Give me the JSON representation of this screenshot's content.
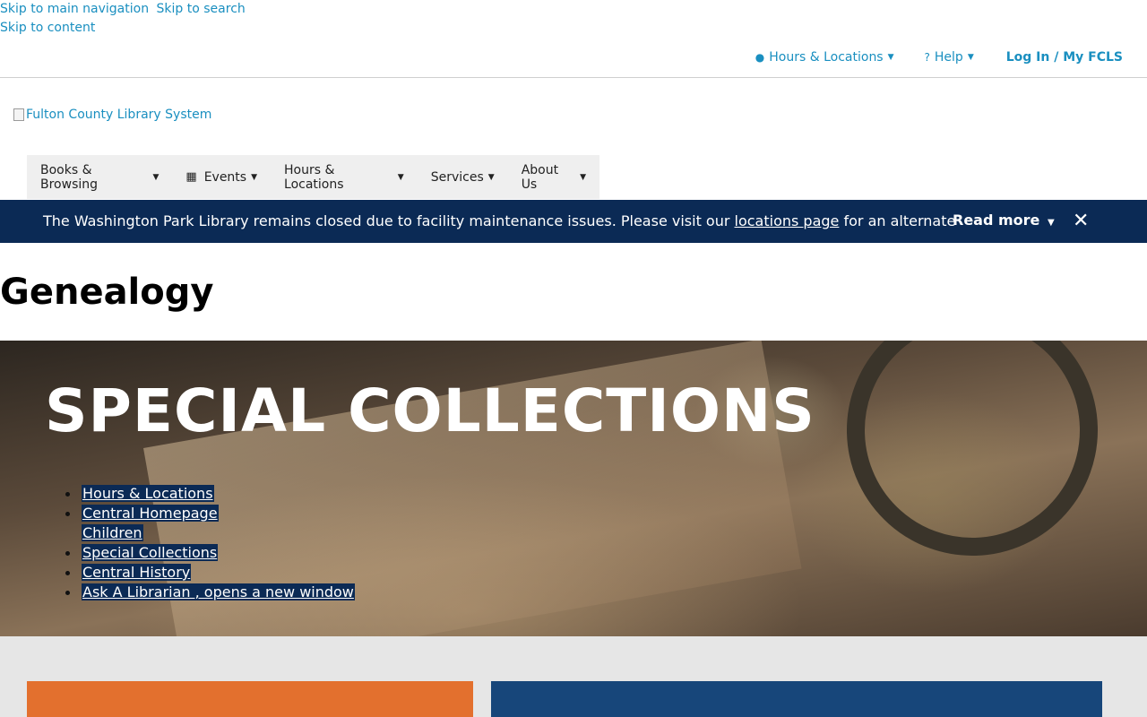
{
  "skip_links": {
    "main_nav": "Skip to main navigation",
    "search": "Skip to search",
    "content": "Skip to content"
  },
  "utility_nav": {
    "hours_locations": "Hours & Locations",
    "help": "Help",
    "login": "Log In / My FCLS"
  },
  "logo": {
    "alt": "Fulton County Library System"
  },
  "main_nav": {
    "items": [
      {
        "label": "Books & Browsing"
      },
      {
        "label": "Events"
      },
      {
        "label": "Hours & Locations"
      },
      {
        "label": "Services"
      },
      {
        "label": "About Us"
      }
    ]
  },
  "alert": {
    "message_before": "The Washington Park Library remains closed due to facility maintenance issues. Please visit our ",
    "link": "locations page",
    "message_after": " for an alternate",
    "read_more": "Read more"
  },
  "page": {
    "title": "Genealogy"
  },
  "hero": {
    "heading": "SPECIAL COLLECTIONS",
    "links": [
      "Hours & Locations",
      "Central Homepage",
      "Children",
      "Special Collections",
      "Central History",
      "Ask A Librarian , opens a new window"
    ]
  },
  "colors": {
    "link": "#1a8fc0",
    "alert_bg": "#0b2a55",
    "card_orange": "#e3702e",
    "card_blue": "#17467a"
  },
  "icons": [
    "map-marker-icon",
    "question-circle-icon",
    "calendar-icon",
    "chevron-down-icon",
    "close-icon"
  ]
}
